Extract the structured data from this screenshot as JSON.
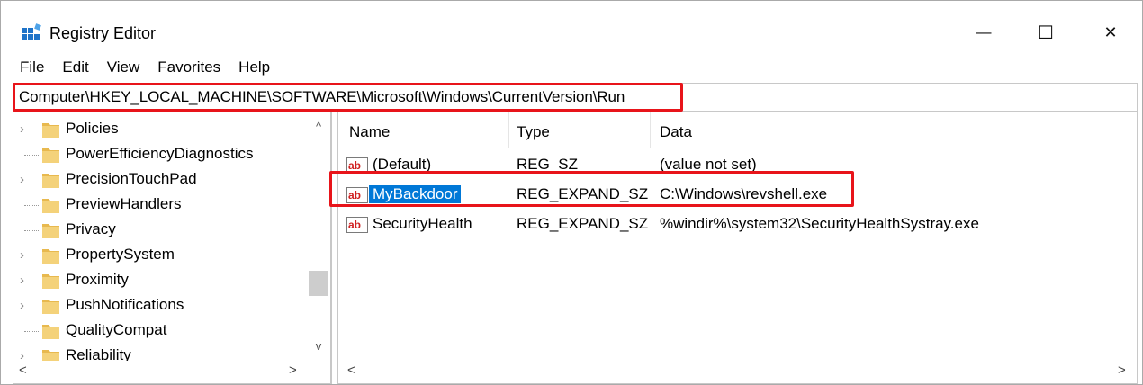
{
  "window": {
    "title": "Registry Editor",
    "controls": {
      "minimize": "—",
      "maximize": "☐",
      "close": "✕"
    }
  },
  "menu": [
    "File",
    "Edit",
    "View",
    "Favorites",
    "Help"
  ],
  "address": {
    "path": "Computer\\HKEY_LOCAL_MACHINE\\SOFTWARE\\Microsoft\\Windows\\CurrentVersion\\Run"
  },
  "tree": {
    "items": [
      {
        "label": "Policies",
        "expandable": true
      },
      {
        "label": "PowerEfficiencyDiagnostics",
        "expandable": false
      },
      {
        "label": "PrecisionTouchPad",
        "expandable": true
      },
      {
        "label": "PreviewHandlers",
        "expandable": false
      },
      {
        "label": "Privacy",
        "expandable": false
      },
      {
        "label": "PropertySystem",
        "expandable": true
      },
      {
        "label": "Proximity",
        "expandable": true
      },
      {
        "label": "PushNotifications",
        "expandable": true
      },
      {
        "label": "QualityCompat",
        "expandable": false
      },
      {
        "label": "Reliability",
        "expandable": true
      }
    ],
    "scroll": {
      "up": "^",
      "down": "v",
      "left": "<",
      "right": ">"
    }
  },
  "values": {
    "columns": {
      "name": "Name",
      "type": "Type",
      "data": "Data"
    },
    "rows": [
      {
        "name": "(Default)",
        "type": "REG_SZ",
        "data": "(value not set)",
        "icon": "string-value-icon",
        "selected": false
      },
      {
        "name": "MyBackdoor",
        "type": "REG_EXPAND_SZ",
        "data": "C:\\Windows\\revshell.exe",
        "icon": "string-value-icon",
        "selected": true
      },
      {
        "name": "SecurityHealth",
        "type": "REG_EXPAND_SZ",
        "data": "%windir%\\system32\\SecurityHealthSystray.exe",
        "icon": "string-value-icon",
        "selected": false
      }
    ],
    "scroll": {
      "left": "<",
      "right": ">"
    }
  },
  "colors": {
    "highlight": "#e8141a",
    "selection": "#0078d7",
    "folder": "#f4d27a"
  }
}
